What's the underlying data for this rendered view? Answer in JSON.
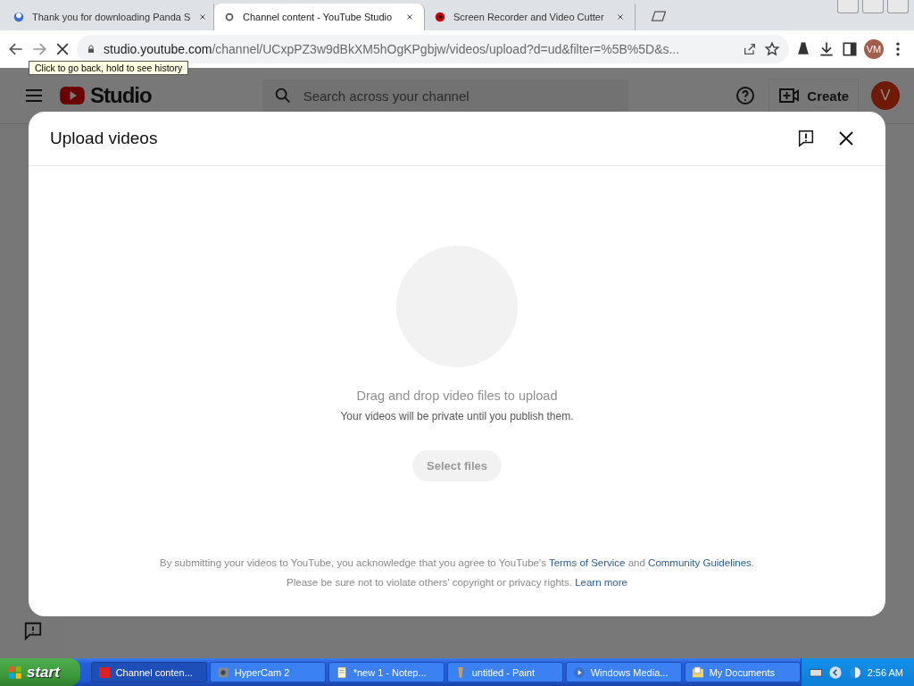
{
  "browser": {
    "tabs": [
      {
        "title": "Thank you for downloading Panda S",
        "selected": false
      },
      {
        "title": "Channel content - YouTube Studio",
        "selected": true
      },
      {
        "title": "Screen Recorder and Video Cutter",
        "selected": false
      }
    ],
    "url_host": "studio.youtube.com",
    "url_path": "/channel/UCxpPZ3w9dBkXM5hOgKPgbjw/videos/upload?d=ud&filter=%5B%5D&s...",
    "profile": "VM",
    "tooltip": "Click to go back, hold to see history"
  },
  "studio": {
    "logo": "Studio",
    "search": {
      "placeholder": "Search across your channel"
    },
    "create": "Create",
    "avatar": "V"
  },
  "dialog": {
    "title": "Upload videos",
    "prompt": "Drag and drop video files to upload",
    "note": "Your videos will be private until you publish them.",
    "button": "Select files",
    "legal": [
      [
        {
          "kind": "text",
          "text": "By submitting your videos to YouTube, you acknowledge that you agree to YouTube's "
        },
        {
          "kind": "link",
          "text": "Terms of Service"
        },
        {
          "kind": "text",
          "text": " and "
        },
        {
          "kind": "link",
          "text": "Community Guidelines"
        },
        {
          "kind": "text",
          "text": "."
        }
      ],
      [
        {
          "kind": "text",
          "text": "Please be sure not to violate others' copyright or privacy rights. "
        },
        {
          "kind": "link",
          "text": "Learn more"
        }
      ]
    ]
  },
  "taskbar": {
    "start": "start",
    "items": [
      {
        "label": "Channel conten...",
        "selected": true
      },
      {
        "label": "HyperCam 2",
        "selected": false
      },
      {
        "label": "*new 1 - Notep...",
        "selected": false
      },
      {
        "label": "untitled - Paint",
        "selected": false
      },
      {
        "label": "Windows Media...",
        "selected": false
      },
      {
        "label": "My Documents",
        "selected": false
      }
    ],
    "clock": "2:56 AM"
  }
}
